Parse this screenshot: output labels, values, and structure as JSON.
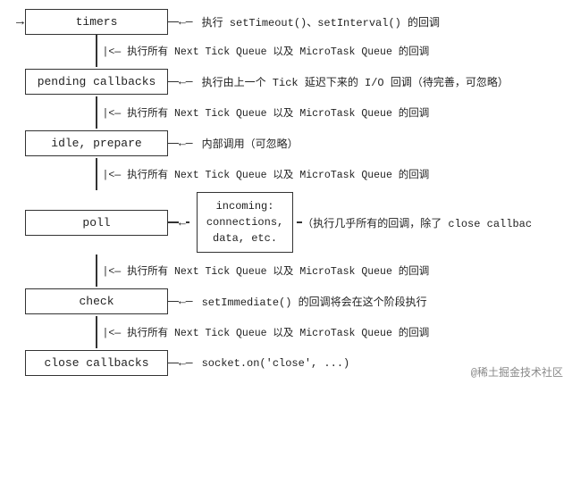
{
  "phases": [
    {
      "id": "timers",
      "label": "timers",
      "annotation": "执行 setTimeout()、setInterval() 的回调",
      "has_loop": true
    },
    {
      "id": "pending-callbacks",
      "label": "pending callbacks",
      "annotation": "执行由上一个 Tick 延迟下来的 I/O 回调（待完善，可忽略）"
    },
    {
      "id": "idle-prepare",
      "label": "idle, prepare",
      "annotation": "内部调用（可忽略）"
    },
    {
      "id": "poll",
      "label": "poll",
      "annotation": "（执行几乎所有的回调，除了 close callbac",
      "has_incoming": true,
      "incoming_label": "incoming:\nconnections,\ndata, etc."
    },
    {
      "id": "check",
      "label": "check",
      "annotation": "setImmediate() 的回调将会在这个阶段执行"
    },
    {
      "id": "close-callbacks",
      "label": "close callbacks",
      "annotation": "socket.on('close', ...)"
    }
  ],
  "tick_queue_label": "|<— 执行所有 Next Tick Queue 以及 MicroTask Queue 的回调",
  "watermark": "@稀土掘金技术社区"
}
